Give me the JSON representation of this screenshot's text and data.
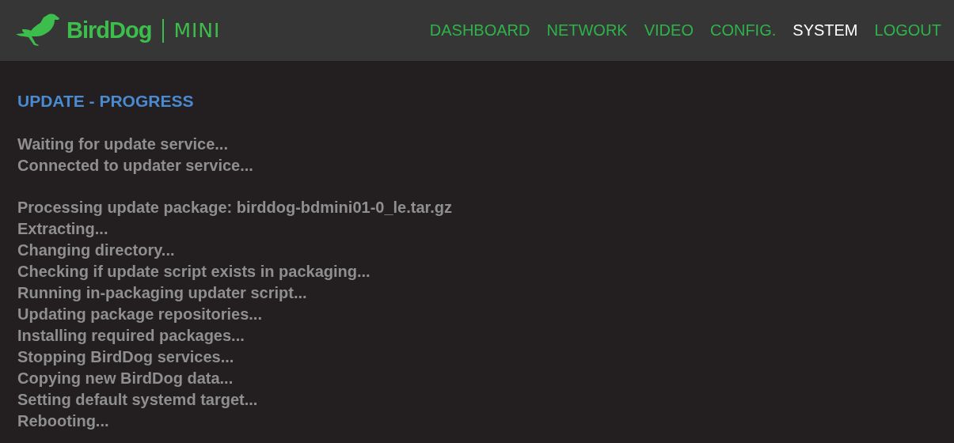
{
  "header": {
    "logo": {
      "brand": "BirdDog",
      "product": "MINI"
    },
    "nav": [
      {
        "label": "DASHBOARD",
        "selected": false
      },
      {
        "label": "NETWORK",
        "selected": false
      },
      {
        "label": "VIDEO",
        "selected": false
      },
      {
        "label": "CONFIG.",
        "selected": false
      },
      {
        "label": "SYSTEM",
        "selected": true
      },
      {
        "label": "LOGOUT",
        "selected": false
      }
    ]
  },
  "content": {
    "title": "UPDATE - PROGRESS",
    "log_groups": [
      [
        "Waiting for update service...",
        "Connected to updater service..."
      ],
      [
        "Processing update package: birddog-bdmini01-0_le.tar.gz",
        "Extracting...",
        "Changing directory...",
        "Checking if update script exists in packaging...",
        "Running in-packaging updater script...",
        "Updating package repositories...",
        "Installing required packages...",
        "Stopping BirdDog services...",
        "Copying new BirdDog data...",
        "Setting default systemd target...",
        "Rebooting..."
      ]
    ]
  }
}
